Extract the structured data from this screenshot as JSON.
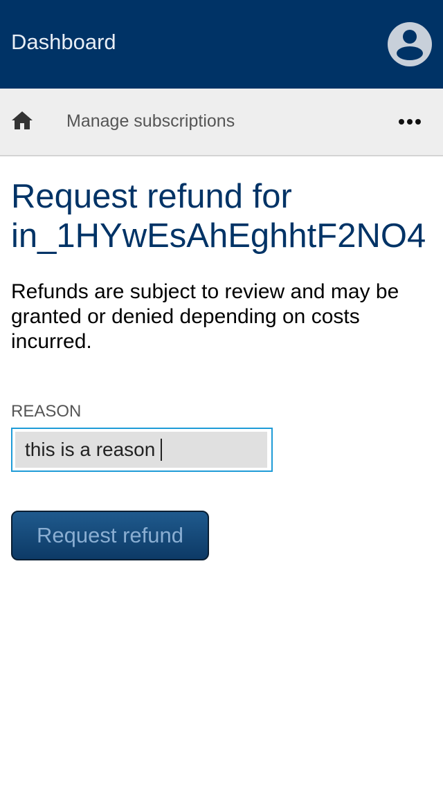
{
  "header": {
    "title": "Dashboard",
    "avatar_icon": "user-avatar-icon"
  },
  "navbar": {
    "home_icon": "home-icon",
    "link_label": "Manage subscriptions",
    "more_icon": "more-horizontal-icon"
  },
  "main": {
    "title_line1": "Request refund for",
    "title_line2": "in_1HYwEsAhEghhtF2NO4",
    "description": "Refunds are subject to review and may be granted or denied depending on costs incurred.",
    "reason_label": "REASON",
    "reason_value": "this is a reason",
    "submit_label": "Request refund"
  },
  "colors": {
    "primary": "#003366",
    "navbar_bg": "#eeeeee",
    "input_focus_border": "#1e9bd7"
  }
}
